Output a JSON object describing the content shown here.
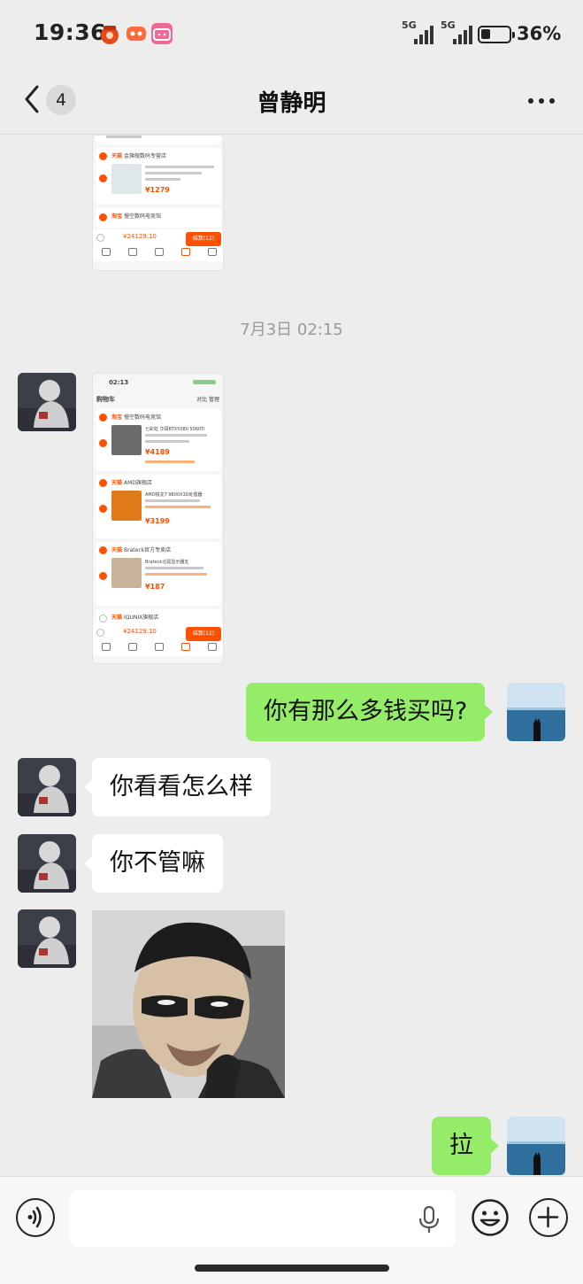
{
  "status_bar": {
    "time": "19:36",
    "network_1": "5G",
    "network_2": "5G",
    "battery_percent": "36%",
    "battery_level": 0.36
  },
  "nav": {
    "unread_count": "4",
    "title": "曾静明",
    "back_icon": "chevron-left-icon",
    "more_icon": "more-dots-icon"
  },
  "chat": {
    "timestamp": "7月3日 02:15",
    "messages": [
      {
        "side": "right",
        "text": "你有那么多钱买吗?"
      },
      {
        "side": "left",
        "text": "你看看怎么样"
      },
      {
        "side": "left",
        "text": "你不管嘛"
      },
      {
        "side": "right",
        "text": "拉"
      }
    ]
  },
  "shot1": {
    "store_1_tag": "天猫",
    "store_1_name": "金旗舰数码专营店",
    "price_1": "¥1279",
    "store_2_tag": "淘宝",
    "store_2_name": "慢空数码电竞馆",
    "total": "¥24129.10",
    "pay": "结算(12)"
  },
  "shot2": {
    "time": "02:13",
    "header": "购物车",
    "header_right": "对比  管理",
    "store_1_tag": "淘宝",
    "store_1_name": "慢空数码电竞馆",
    "item_1": "七彩虹 华硕RTX5080 5060Ti",
    "price_1": "¥4189",
    "store_2_tag": "天猫",
    "store_2_name": "AMD旗舰店",
    "item_2": "AMD锐龙7 9800X3D处理器",
    "price_2": "¥3199",
    "store_3_tag": "天猫",
    "store_3_name": "Brateck官方专卖店",
    "item_3": "Brateck北弧显示器支",
    "price_3": "¥187",
    "store_4_tag": "天猫",
    "store_4_name": "IQUNIX旗舰店",
    "total": "¥24129.10",
    "pay": "结算(12)"
  },
  "input": {
    "placeholder": "",
    "voice_icon": "voice-icon",
    "mic_icon": "microphone-icon",
    "emoji_icon": "emoji-icon",
    "plus_icon": "plus-icon"
  },
  "colors": {
    "background": "#ededed",
    "bubble_self": "#95ec69",
    "bubble_other": "#ffffff",
    "taobao_orange": "#ff5000"
  }
}
